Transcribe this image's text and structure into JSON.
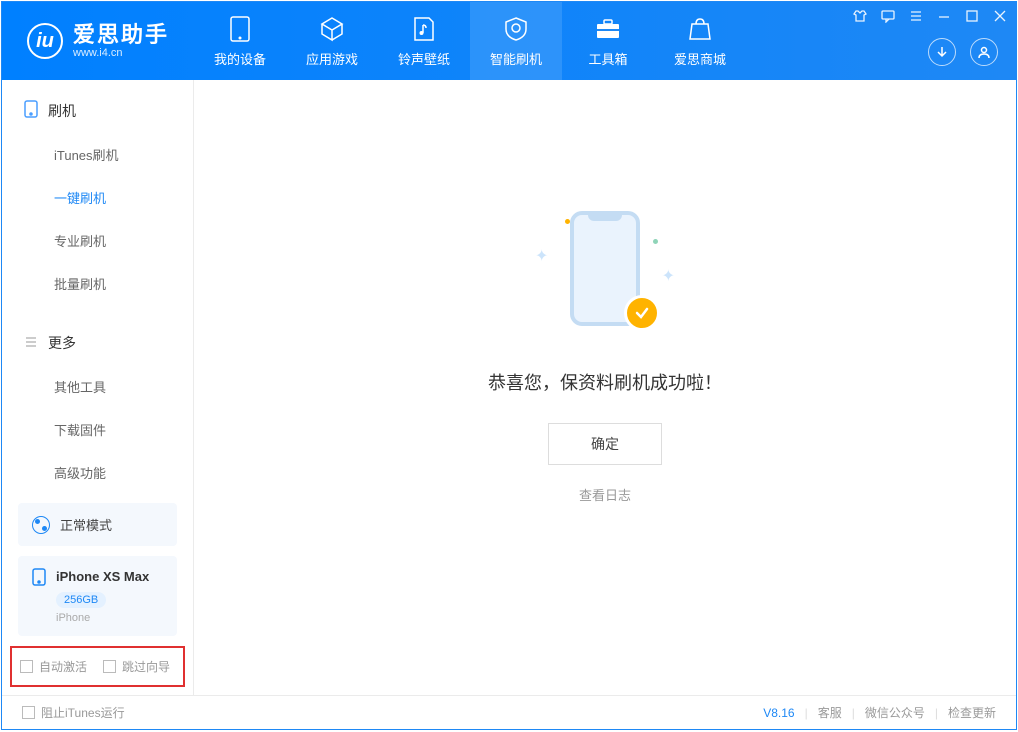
{
  "app": {
    "title": "爱思助手",
    "url": "www.i4.cn"
  },
  "nav": {
    "tabs": [
      {
        "label": "我的设备"
      },
      {
        "label": "应用游戏"
      },
      {
        "label": "铃声壁纸"
      },
      {
        "label": "智能刷机"
      },
      {
        "label": "工具箱"
      },
      {
        "label": "爱思商城"
      }
    ]
  },
  "sidebar": {
    "section1": {
      "title": "刷机",
      "items": [
        "iTunes刷机",
        "一键刷机",
        "专业刷机",
        "批量刷机"
      ]
    },
    "section2": {
      "title": "更多",
      "items": [
        "其他工具",
        "下载固件",
        "高级功能"
      ]
    },
    "mode": "正常模式",
    "device": {
      "name": "iPhone XS Max",
      "capacity": "256GB",
      "type": "iPhone"
    },
    "checks": {
      "auto_activate": "自动激活",
      "skip_guide": "跳过向导"
    }
  },
  "main": {
    "success": "恭喜您，保资料刷机成功啦！",
    "ok": "确定",
    "log": "查看日志"
  },
  "footer": {
    "block_itunes": "阻止iTunes运行",
    "version": "V8.16",
    "support": "客服",
    "wechat": "微信公众号",
    "update": "检查更新"
  }
}
